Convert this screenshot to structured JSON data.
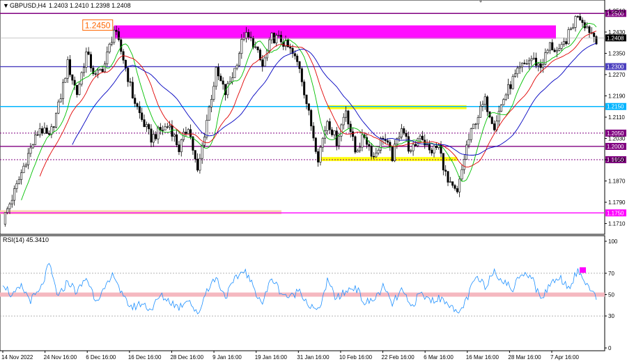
{
  "chart_data": [
    {
      "type": "candlestick",
      "title": "GBPUSD,H4",
      "ohlc_label": "1.2403 1.2410 1.2398 1.2408",
      "ylim": [
        1.168,
        1.254
      ],
      "y_ticks": [
        "1.2510",
        "1.2430",
        "1.2350",
        "1.2270",
        "1.2190",
        "1.2110",
        "1.2030",
        "1.1950",
        "1.1870",
        "1.1790",
        "1.1710"
      ],
      "levels": [
        {
          "value": 1.25,
          "label": "1.2500",
          "color": "#800080",
          "style": "solid"
        },
        {
          "value": 1.23,
          "label": "1.2300",
          "color": "#4b3fbf",
          "style": "solid"
        },
        {
          "value": 1.215,
          "label": "1.2150",
          "color": "#00b4ff",
          "style": "solid"
        },
        {
          "value": 1.205,
          "label": "1.2050",
          "color": "#800080",
          "style": "dotted"
        },
        {
          "value": 1.2,
          "label": "1.2000",
          "color": "#800080",
          "style": "solid"
        },
        {
          "value": 1.195,
          "label": "1.1950",
          "color": "#800080",
          "style": "dotted"
        },
        {
          "value": 1.175,
          "label": "1.1750",
          "color": "#ff00ff",
          "style": "solid"
        }
      ],
      "current_price": {
        "value": 1.2408,
        "label": "1.2408"
      },
      "zones": [
        {
          "from": 1.2405,
          "to": 1.2455,
          "color": "#ff00ff",
          "label": "1.2450"
        },
        {
          "from": 1.214,
          "to": 1.2155,
          "color": "#ffff00"
        },
        {
          "from": 1.1945,
          "to": 1.196,
          "color": "#ffff00"
        },
        {
          "from": 1.1745,
          "to": 1.176,
          "color": "#f5cfa8"
        }
      ],
      "price_path": [
        [
          0,
          1.172
        ],
        [
          3,
          1.185
        ],
        [
          5,
          1.195
        ],
        [
          8,
          1.207
        ],
        [
          10,
          1.203
        ],
        [
          12,
          1.215
        ],
        [
          14,
          1.231
        ],
        [
          16,
          1.22
        ],
        [
          18,
          1.235
        ],
        [
          20,
          1.226
        ],
        [
          22,
          1.231
        ],
        [
          24,
          1.244
        ],
        [
          26,
          1.233
        ],
        [
          28,
          1.219
        ],
        [
          30,
          1.21
        ],
        [
          32,
          1.203
        ],
        [
          34,
          1.206
        ],
        [
          36,
          1.208
        ],
        [
          38,
          1.199
        ],
        [
          40,
          1.208
        ],
        [
          42,
          1.19
        ],
        [
          44,
          1.21
        ],
        [
          46,
          1.228
        ],
        [
          48,
          1.22
        ],
        [
          50,
          1.229
        ],
        [
          52,
          1.242
        ],
        [
          54,
          1.239
        ],
        [
          56,
          1.23
        ],
        [
          58,
          1.241
        ],
        [
          60,
          1.24
        ],
        [
          62,
          1.236
        ],
        [
          64,
          1.23
        ],
        [
          66,
          1.212
        ],
        [
          68,
          1.196
        ],
        [
          70,
          1.21
        ],
        [
          72,
          1.202
        ],
        [
          74,
          1.214
        ],
        [
          76,
          1.198
        ],
        [
          78,
          1.204
        ],
        [
          80,
          1.196
        ],
        [
          82,
          1.204
        ],
        [
          84,
          1.196
        ],
        [
          86,
          1.208
        ],
        [
          88,
          1.197
        ],
        [
          90,
          1.205
        ],
        [
          92,
          1.198
        ],
        [
          94,
          1.2
        ],
        [
          96,
          1.186
        ],
        [
          98,
          1.182
        ],
        [
          100,
          1.2
        ],
        [
          102,
          1.21
        ],
        [
          104,
          1.217
        ],
        [
          106,
          1.208
        ],
        [
          108,
          1.218
        ],
        [
          110,
          1.225
        ],
        [
          112,
          1.23
        ],
        [
          114,
          1.233
        ],
        [
          116,
          1.23
        ],
        [
          118,
          1.238
        ],
        [
          120,
          1.235
        ],
        [
          122,
          1.242
        ],
        [
          124,
          1.25
        ],
        [
          126,
          1.245
        ],
        [
          128,
          1.2405
        ]
      ],
      "ma_colors": [
        "#00c000",
        "#e00000",
        "#0000c0"
      ],
      "candle_color": "#000000",
      "x_ticks": [
        "14 Nov 2022",
        "24 Nov 16:00",
        "6 Dec 16:00",
        "16 Dec 16:00",
        "28 Dec 16:00",
        "9 Jan 16:00",
        "19 Jan 16:00",
        "31 Jan 16:00",
        "10 Feb 16:00",
        "22 Feb 16:00",
        "6 Mar 16:00",
        "16 Mar 16:00",
        "28 Mar 16:00",
        "7 Apr 16:00"
      ]
    },
    {
      "type": "line",
      "title": "RSI(14) 45.3410",
      "ylim": [
        0,
        100
      ],
      "y_ticks": [
        "100",
        "70",
        "50",
        "30",
        "0"
      ],
      "dotted_levels": [
        70,
        30
      ],
      "highlight_level": 50,
      "line_color": "#1e90ff",
      "band_color": "#f5b8c0",
      "marker": {
        "x": 125,
        "y": 73,
        "color": "#ff00ff"
      },
      "values": [
        [
          0,
          62
        ],
        [
          2,
          48
        ],
        [
          4,
          57
        ],
        [
          6,
          45
        ],
        [
          8,
          53
        ],
        [
          10,
          78
        ],
        [
          12,
          47
        ],
        [
          14,
          63
        ],
        [
          16,
          52
        ],
        [
          18,
          66
        ],
        [
          20,
          46
        ],
        [
          22,
          54
        ],
        [
          24,
          70
        ],
        [
          26,
          46
        ],
        [
          28,
          38
        ],
        [
          30,
          42
        ],
        [
          32,
          36
        ],
        [
          34,
          49
        ],
        [
          36,
          44
        ],
        [
          38,
          38
        ],
        [
          40,
          47
        ],
        [
          42,
          30
        ],
        [
          44,
          55
        ],
        [
          46,
          66
        ],
        [
          48,
          48
        ],
        [
          50,
          63
        ],
        [
          52,
          74
        ],
        [
          54,
          57
        ],
        [
          56,
          42
        ],
        [
          58,
          66
        ],
        [
          60,
          52
        ],
        [
          62,
          47
        ],
        [
          64,
          55
        ],
        [
          66,
          40
        ],
        [
          68,
          34
        ],
        [
          70,
          62
        ],
        [
          72,
          46
        ],
        [
          74,
          53
        ],
        [
          76,
          58
        ],
        [
          78,
          42
        ],
        [
          80,
          45
        ],
        [
          82,
          57
        ],
        [
          84,
          41
        ],
        [
          86,
          54
        ],
        [
          88,
          38
        ],
        [
          90,
          51
        ],
        [
          92,
          45
        ],
        [
          94,
          46
        ],
        [
          96,
          44
        ],
        [
          98,
          30
        ],
        [
          100,
          45
        ],
        [
          102,
          66
        ],
        [
          104,
          58
        ],
        [
          106,
          73
        ],
        [
          108,
          62
        ],
        [
          110,
          55
        ],
        [
          112,
          72
        ],
        [
          114,
          67
        ],
        [
          116,
          45
        ],
        [
          118,
          60
        ],
        [
          120,
          67
        ],
        [
          122,
          57
        ],
        [
          124,
          72
        ],
        [
          126,
          60
        ],
        [
          128,
          45
        ]
      ]
    }
  ]
}
